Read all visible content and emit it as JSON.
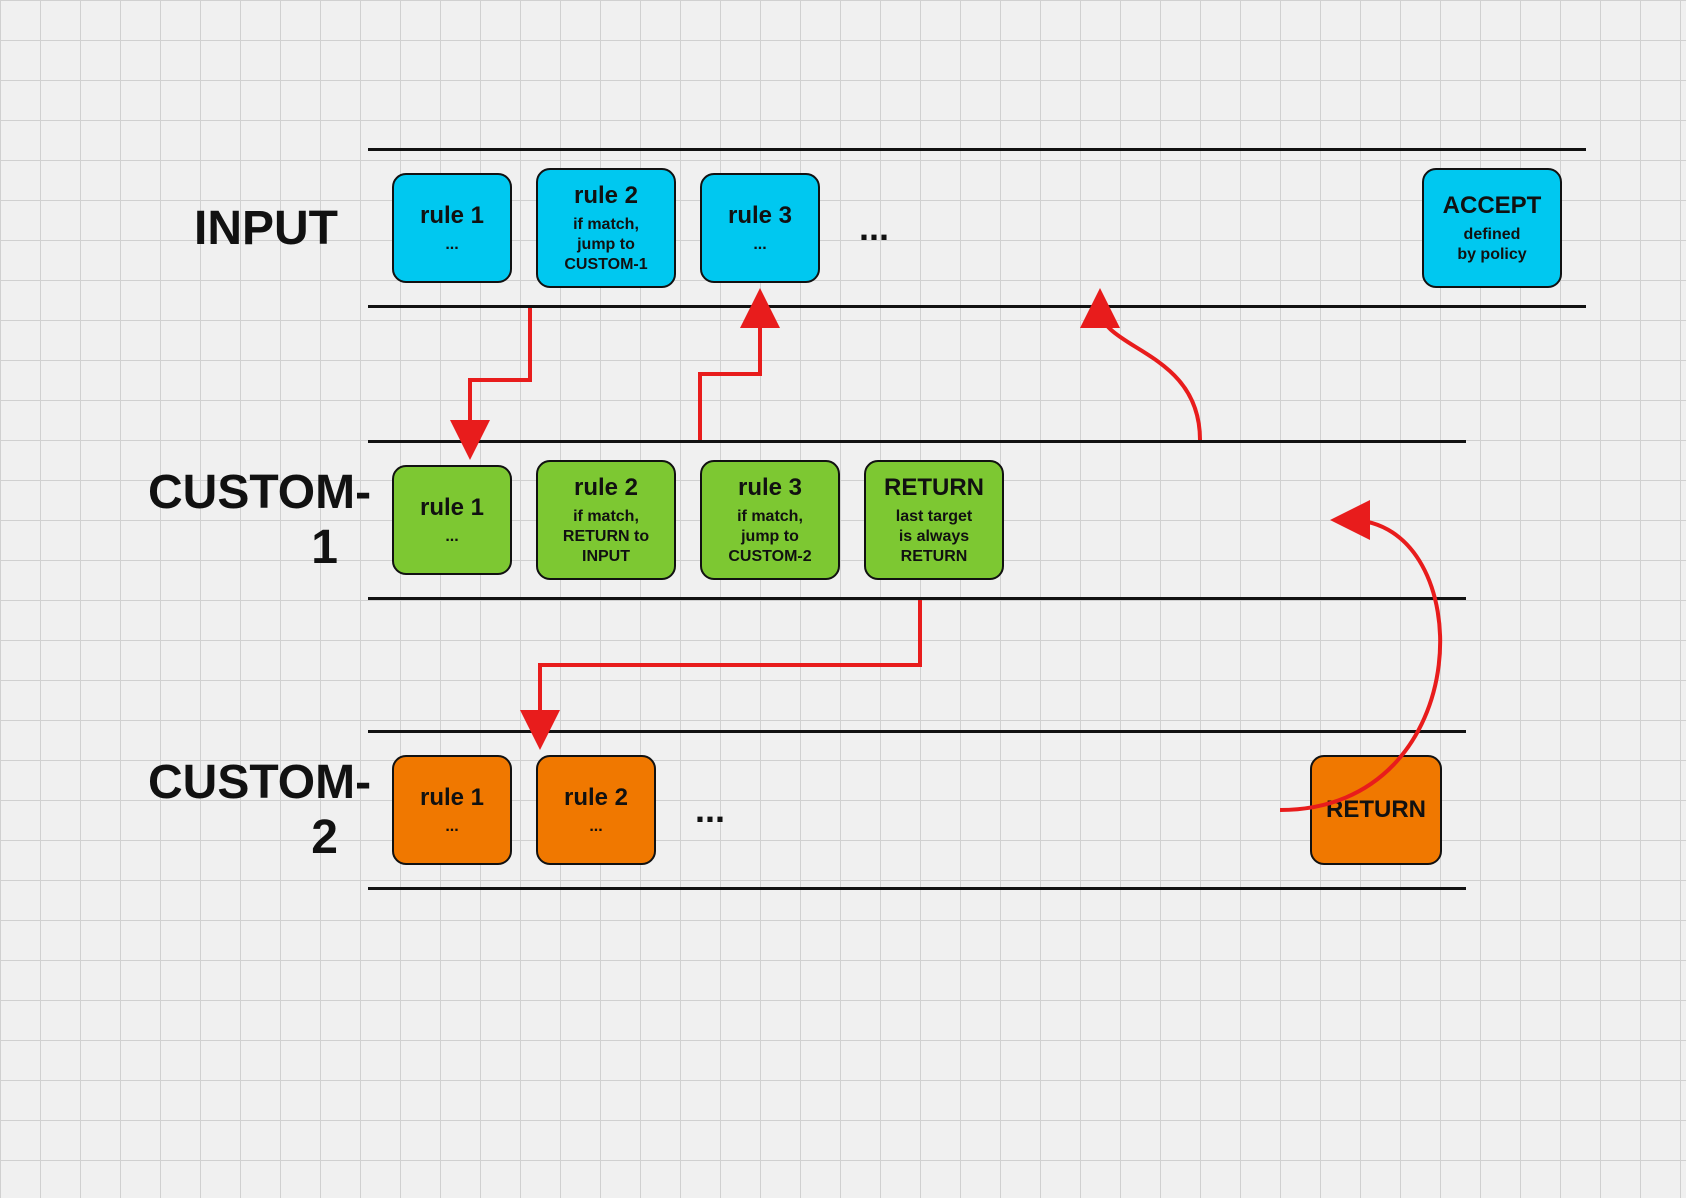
{
  "chains": {
    "input": {
      "label": "INPUT",
      "rules": [
        {
          "id": "input-r1",
          "title": "rule 1",
          "sub": "..."
        },
        {
          "id": "input-r2",
          "title": "rule 2",
          "sub": "if match,\njump to\nCUSTOM-1"
        },
        {
          "id": "input-r3",
          "title": "rule 3",
          "sub": "..."
        },
        {
          "id": "input-ellipsis",
          "title": "...",
          "sub": null
        },
        {
          "id": "input-accept",
          "title": "ACCEPT",
          "sub": "defined\nby policy"
        }
      ]
    },
    "custom1": {
      "label": "CUSTOM-1",
      "rules": [
        {
          "id": "c1-r1",
          "title": "rule 1",
          "sub": "..."
        },
        {
          "id": "c1-r2",
          "title": "rule 2",
          "sub": "if match,\nRETURN to\nINPUT"
        },
        {
          "id": "c1-r3",
          "title": "rule 3",
          "sub": "if match,\njump to\nCUSTOM-2"
        },
        {
          "id": "c1-return",
          "title": "RETURN",
          "sub": "last target\nis always\nRETURN"
        }
      ]
    },
    "custom2": {
      "label": "CUSTOM-2",
      "rules": [
        {
          "id": "c2-r1",
          "title": "rule 1",
          "sub": "..."
        },
        {
          "id": "c2-r2",
          "title": "rule 2",
          "sub": "..."
        },
        {
          "id": "c2-ellipsis",
          "title": "...",
          "sub": null
        },
        {
          "id": "c2-return",
          "title": "RETURN",
          "sub": null
        }
      ]
    }
  },
  "arrows": {
    "colors": {
      "arrow": "#e81c1c"
    }
  }
}
